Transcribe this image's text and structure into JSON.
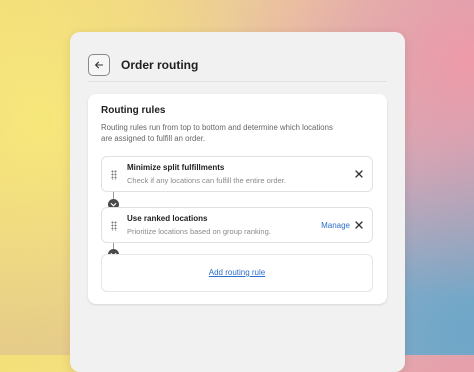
{
  "header": {
    "title": "Order routing",
    "back_icon": "arrow-left-icon"
  },
  "card": {
    "title": "Routing rules",
    "description": "Routing rules run from top to bottom and determine which locations are assigned to fulfill an order."
  },
  "rules": [
    {
      "title": "Minimize split fulfillments",
      "description": "Check if any locations can fulfill the entire order."
    },
    {
      "title": "Use ranked locations",
      "description": "Prioritize locations based on group ranking.",
      "action_label": "Manage"
    }
  ],
  "add_rule_label": "Add routing rule",
  "colors": {
    "link": "#2c6ecb",
    "panel": "#f1f1f1",
    "card": "#ffffff"
  }
}
